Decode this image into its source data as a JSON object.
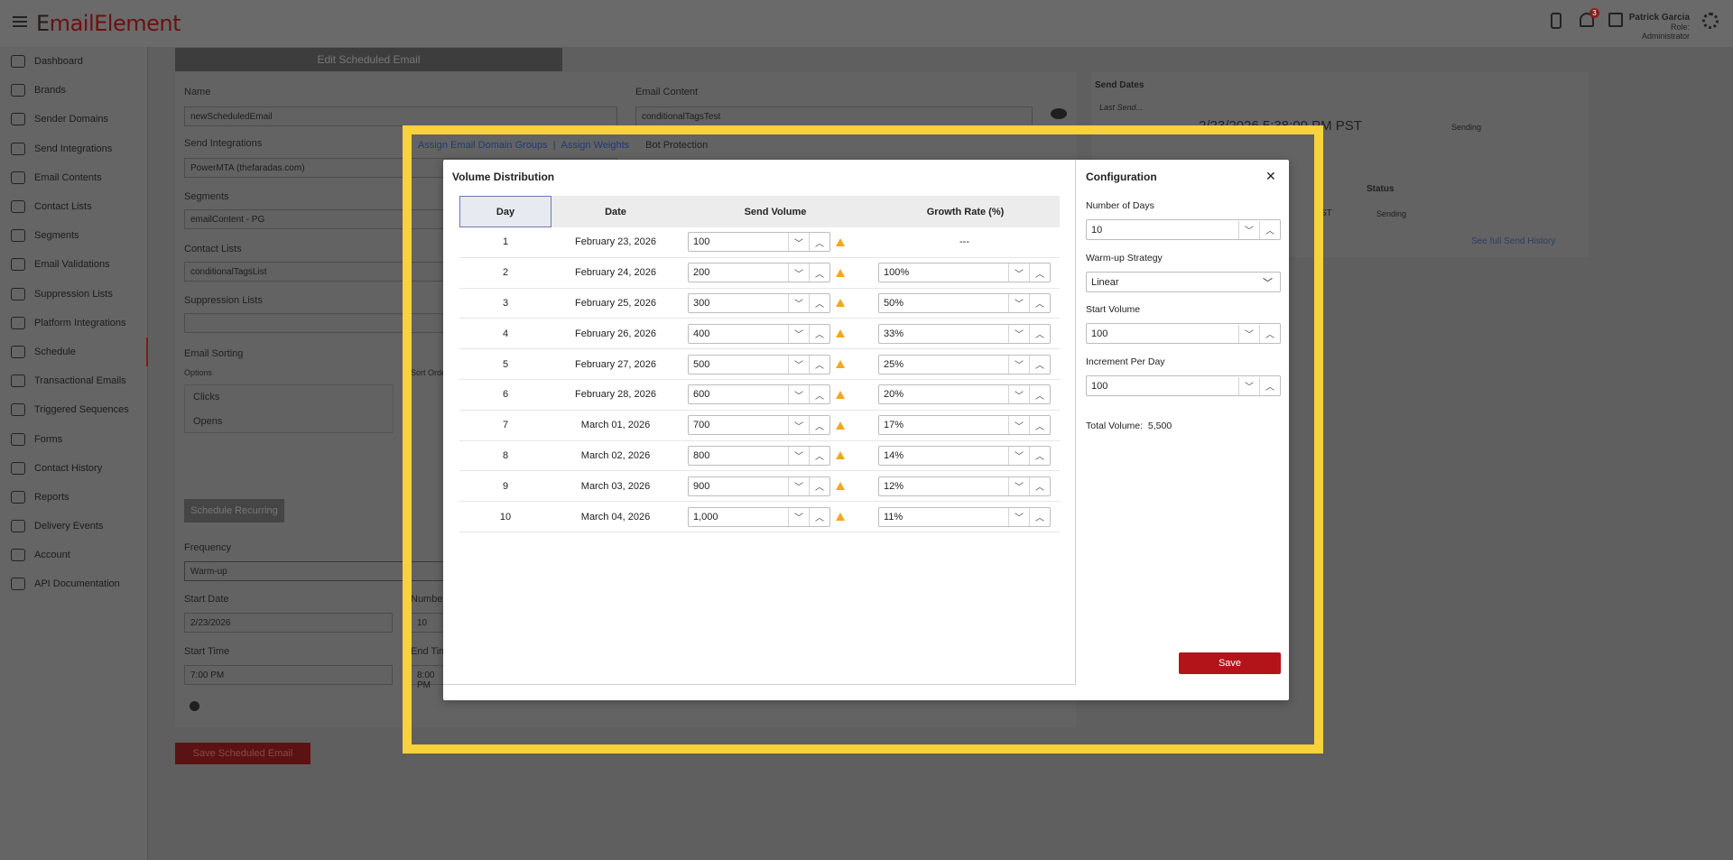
{
  "app": {
    "logo_prefix": "E",
    "logo_mid": "ail",
    "logo_suffix": "Element",
    "notification_count": "3",
    "user_name": "Patrick Garcia",
    "user_role": "Role: Administrator"
  },
  "sidebar": {
    "items": [
      {
        "label": "Dashboard",
        "icon": "gauge-icon"
      },
      {
        "label": "Brands",
        "icon": "id-card-icon"
      },
      {
        "label": "Sender Domains",
        "icon": "globe-icon"
      },
      {
        "label": "Send Integrations",
        "icon": "wrench-icon"
      },
      {
        "label": "Email Contents",
        "icon": "envelope-icon"
      },
      {
        "label": "Contact Lists",
        "icon": "list-icon"
      },
      {
        "label": "Segments",
        "icon": "segment-icon"
      },
      {
        "label": "Email Validations",
        "icon": "check-circle-icon"
      },
      {
        "label": "Suppression Lists",
        "icon": "alert-circle-icon"
      },
      {
        "label": "Platform Integrations",
        "icon": "tag-icon"
      },
      {
        "label": "Schedule",
        "icon": "refresh-icon"
      },
      {
        "label": "Transactional Emails",
        "icon": "at-icon"
      },
      {
        "label": "Triggered Sequences",
        "icon": "bolt-icon"
      },
      {
        "label": "Forms",
        "icon": "document-icon"
      },
      {
        "label": "Contact History",
        "icon": "clipboard-icon"
      },
      {
        "label": "Reports",
        "icon": "report-icon"
      },
      {
        "label": "Delivery Events",
        "icon": "bar-chart-icon"
      },
      {
        "label": "Account",
        "icon": "account-icon"
      },
      {
        "label": "API Documentation",
        "icon": "code-icon"
      }
    ]
  },
  "background": {
    "tab_title": "Edit Scheduled Email",
    "name_label": "Name",
    "name_value": "newScheduledEmail",
    "send_integrations_label": "Send Integrations",
    "send_integrations_value": "PowerMTA (thefaradas.com)",
    "segments_label": "Segments",
    "segments_value": "emailContent - PG",
    "contact_lists_label": "Contact Lists",
    "contact_lists_value": "conditionalTagsList",
    "suppression_label": "Suppression Lists",
    "email_sorting_label": "Email Sorting",
    "options_label": "Options",
    "sort_order_label": "Sort Orde",
    "option_clicks": "Clicks",
    "option_opens": "Opens",
    "schedule_recurring": "Schedule Recurring",
    "frequency_label": "Frequency",
    "frequency_value": "Warm-up",
    "number_label": "Number",
    "number_value": "10",
    "start_date_label": "Start Date",
    "start_date_value": "2/23/2026",
    "start_time_label": "Start Time",
    "start_time_value": "7:00 PM",
    "end_time_label": "End Tim",
    "end_time_value": "8:00 PM",
    "save_scheduled": "Save Scheduled Email",
    "email_content_label": "Email Content",
    "email_content_value": "conditionalTagsTest",
    "send_dates_label": "Send Dates",
    "last_send_label": "Last Send...",
    "last_send_value": "2/23/2026 5:38:00 PM PST",
    "status_sending": "Sending",
    "status_header": "Status",
    "st_fragment": "ST",
    "status_sending_2": "Sending",
    "see_history": "See full Send History"
  },
  "overlay_links": {
    "assign_groups": "Assign Email Domain Groups",
    "separator": "|",
    "assign_weights": "Assign Weights",
    "bot_protection": "Bot Protection"
  },
  "modal": {
    "title": "Volume Distribution",
    "columns": {
      "day": "Day",
      "date": "Date",
      "volume": "Send Volume",
      "growth": "Growth Rate (%)"
    },
    "rows": [
      {
        "day": "1",
        "date": "February 23, 2026",
        "volume": "100",
        "growth": "---"
      },
      {
        "day": "2",
        "date": "February 24, 2026",
        "volume": "200",
        "growth": "100%"
      },
      {
        "day": "3",
        "date": "February 25, 2026",
        "volume": "300",
        "growth": "50%"
      },
      {
        "day": "4",
        "date": "February 26, 2026",
        "volume": "400",
        "growth": "33%"
      },
      {
        "day": "5",
        "date": "February 27, 2026",
        "volume": "500",
        "growth": "25%"
      },
      {
        "day": "6",
        "date": "February 28, 2026",
        "volume": "600",
        "growth": "20%"
      },
      {
        "day": "7",
        "date": "March 01, 2026",
        "volume": "700",
        "growth": "17%"
      },
      {
        "day": "8",
        "date": "March 02, 2026",
        "volume": "800",
        "growth": "14%"
      },
      {
        "day": "9",
        "date": "March 03, 2026",
        "volume": "900",
        "growth": "12%"
      },
      {
        "day": "10",
        "date": "March 04, 2026",
        "volume": "1,000",
        "growth": "11%"
      }
    ],
    "config": {
      "title": "Configuration",
      "days_label": "Number of Days",
      "days_value": "10",
      "strategy_label": "Warm-up Strategy",
      "strategy_value": "Linear",
      "start_label": "Start Volume",
      "start_value": "100",
      "increment_label": "Increment Per Day",
      "increment_value": "100",
      "total_label": "Total Volume:",
      "total_value": "5,500",
      "save_label": "Save"
    }
  },
  "colors": {
    "highlight": "#f7d23b",
    "save_button": "#b3141a",
    "warning": "#f3a81c",
    "link": "#1e3a7a"
  }
}
